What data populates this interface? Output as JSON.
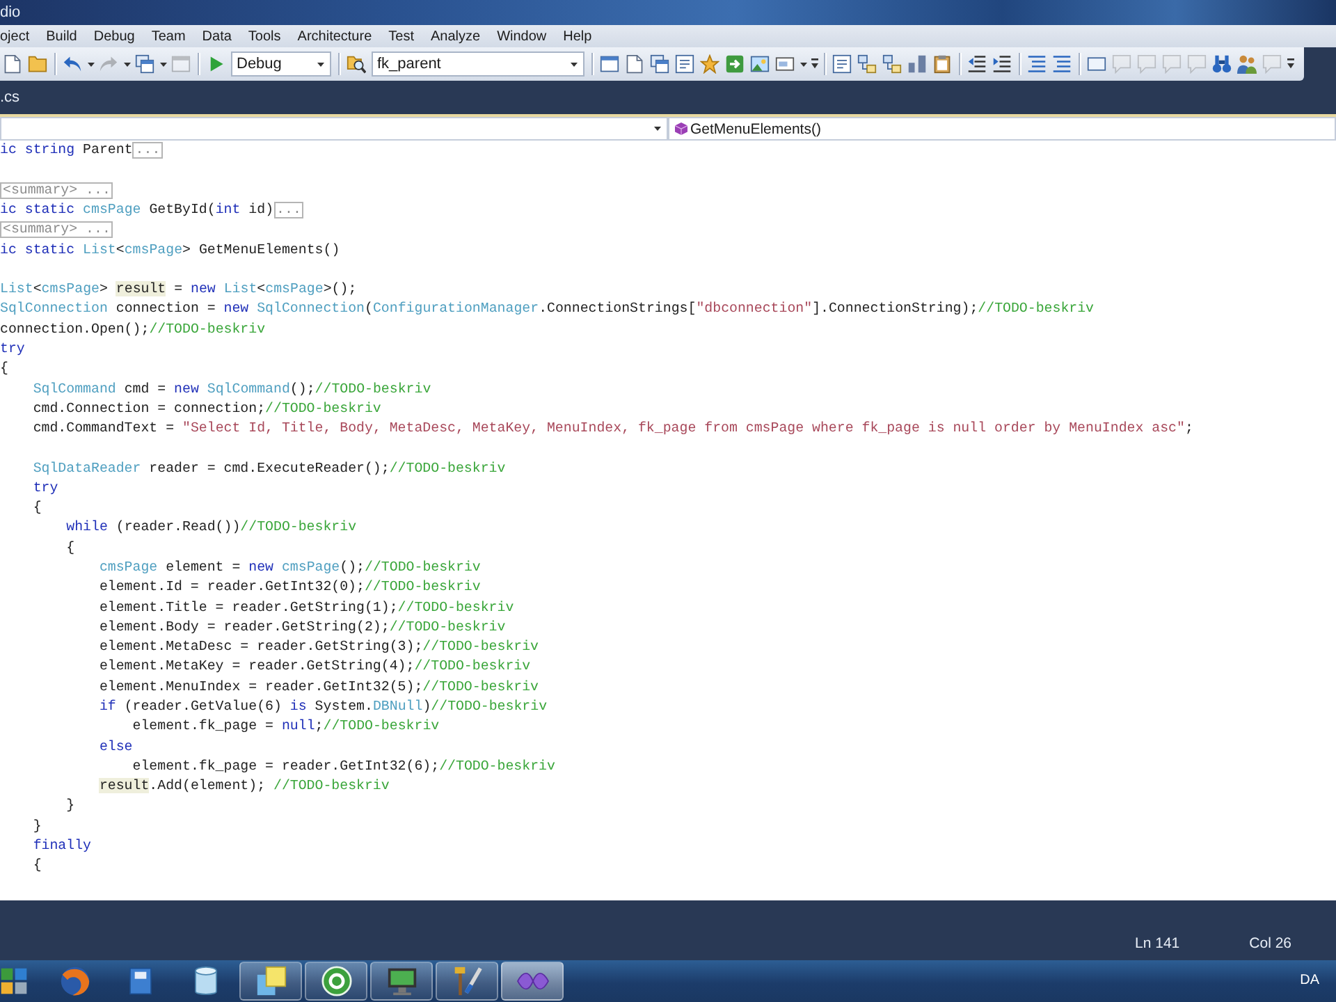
{
  "window": {
    "title": "dio"
  },
  "menu": [
    "oject",
    "Build",
    "Debug",
    "Team",
    "Data",
    "Tools",
    "Architecture",
    "Test",
    "Analyze",
    "Window",
    "Help"
  ],
  "toolbar": {
    "configuration": "Debug",
    "find": "fk_parent",
    "buttons": [
      {
        "disabled": false
      },
      {
        "disabled": false
      },
      {
        "disabled": false
      },
      {
        "disabled": true
      },
      {
        "disabled": false
      },
      {
        "disabled": true
      },
      {
        "disabled": false
      },
      {
        "disabled": false
      },
      {
        "disabled": false
      },
      {
        "disabled": false
      },
      {
        "disabled": false
      },
      {
        "disabled": false
      },
      {
        "disabled": false
      },
      {
        "disabled": false
      },
      {
        "disabled": false
      },
      {
        "disabled": false
      },
      {
        "disabled": false
      },
      {
        "disabled": false
      },
      {
        "disabled": false
      },
      {
        "disabled": false
      },
      {
        "disabled": false
      },
      {
        "disabled": false
      },
      {
        "disabled": false
      },
      {
        "disabled": false
      },
      {
        "disabled": false
      },
      {
        "disabled": false
      },
      {
        "disabled": true
      },
      {
        "disabled": true
      },
      {
        "disabled": true
      },
      {
        "disabled": true
      },
      {
        "disabled": false
      },
      {
        "disabled": false
      },
      {
        "disabled": true
      }
    ]
  },
  "tabs": [
    {
      "label": ".cs",
      "selected": false
    }
  ],
  "navigation": {
    "member": "GetMenuElements()"
  },
  "code": {
    "lines": [
      {
        "kind": "code",
        "tokens": [
          {
            "kind": "keyword",
            "text": "ic string"
          },
          {
            "kind": "plain",
            "text": " Parent"
          },
          {
            "kind": "collapsed",
            "text": "..."
          }
        ]
      },
      {
        "kind": "blank"
      },
      {
        "kind": "code",
        "tokens": [
          {
            "kind": "collapsed",
            "text": "<summary> ..."
          }
        ]
      },
      {
        "kind": "code",
        "tokens": [
          {
            "kind": "keyword",
            "text": "ic static "
          },
          {
            "kind": "type",
            "text": "cmsPage"
          },
          {
            "kind": "plain",
            "text": " GetById("
          },
          {
            "kind": "keyword",
            "text": "int"
          },
          {
            "kind": "plain",
            "text": " id)"
          },
          {
            "kind": "collapsed",
            "text": "..."
          }
        ]
      },
      {
        "kind": "code",
        "tokens": [
          {
            "kind": "collapsed",
            "text": "<summary> ..."
          }
        ]
      },
      {
        "kind": "code",
        "tokens": [
          {
            "kind": "keyword",
            "text": "ic static "
          },
          {
            "kind": "type",
            "text": "List"
          },
          {
            "kind": "plain",
            "text": "<"
          },
          {
            "kind": "type",
            "text": "cmsPage"
          },
          {
            "kind": "plain",
            "text": "> GetMenuElements()"
          }
        ]
      },
      {
        "kind": "blank"
      },
      {
        "kind": "code",
        "tokens": [
          {
            "kind": "type",
            "text": "List"
          },
          {
            "kind": "plain",
            "text": "<"
          },
          {
            "kind": "type",
            "text": "cmsPage"
          },
          {
            "kind": "plain",
            "text": "> "
          },
          {
            "kind": "highlight",
            "text": "result"
          },
          {
            "kind": "plain",
            "text": " = "
          },
          {
            "kind": "keyword",
            "text": "new "
          },
          {
            "kind": "type",
            "text": "List"
          },
          {
            "kind": "plain",
            "text": "<"
          },
          {
            "kind": "type",
            "text": "cmsPage"
          },
          {
            "kind": "plain",
            "text": ">();"
          }
        ]
      },
      {
        "kind": "code",
        "tokens": [
          {
            "kind": "type",
            "text": "SqlConnection"
          },
          {
            "kind": "plain",
            "text": " connection = "
          },
          {
            "kind": "keyword",
            "text": "new "
          },
          {
            "kind": "type",
            "text": "SqlConnection"
          },
          {
            "kind": "plain",
            "text": "("
          },
          {
            "kind": "type",
            "text": "ConfigurationManager"
          },
          {
            "kind": "plain",
            "text": ".ConnectionStrings["
          },
          {
            "kind": "string",
            "text": "\"dbconnection\""
          },
          {
            "kind": "plain",
            "text": "].ConnectionString);"
          },
          {
            "kind": "comment",
            "text": "//TODO-beskriv"
          }
        ]
      },
      {
        "kind": "code",
        "tokens": [
          {
            "kind": "plain",
            "text": "connection.Open();"
          },
          {
            "kind": "comment",
            "text": "//TODO-beskriv"
          }
        ]
      },
      {
        "kind": "code",
        "tokens": [
          {
            "kind": "keyword",
            "text": "try"
          }
        ]
      },
      {
        "kind": "code",
        "tokens": [
          {
            "kind": "plain",
            "text": "{"
          }
        ],
        "children": [
          {
            "kind": "code",
            "tokens": [
              {
                "kind": "type",
                "text": "SqlCommand"
              },
              {
                "kind": "plain",
                "text": " cmd = "
              },
              {
                "kind": "keyword",
                "text": "new "
              },
              {
                "kind": "type",
                "text": "SqlCommand"
              },
              {
                "kind": "plain",
                "text": "();"
              },
              {
                "kind": "comment",
                "text": "//TODO-beskriv"
              }
            ]
          },
          {
            "kind": "code",
            "tokens": [
              {
                "kind": "plain",
                "text": "cmd.Connection = connection;"
              },
              {
                "kind": "comment",
                "text": "//TODO-beskriv"
              }
            ]
          },
          {
            "kind": "code",
            "tokens": [
              {
                "kind": "plain",
                "text": "cmd.CommandText = "
              },
              {
                "kind": "string",
                "text": "\"Select Id, Title, Body, MetaDesc, MetaKey, MenuIndex, fk_page from cmsPage where fk_page is null order by MenuIndex asc\""
              },
              {
                "kind": "plain",
                "text": ";"
              }
            ]
          },
          {
            "kind": "blank"
          },
          {
            "kind": "code",
            "tokens": [
              {
                "kind": "type",
                "text": "SqlDataReader"
              },
              {
                "kind": "plain",
                "text": " reader = cmd.ExecuteReader();"
              },
              {
                "kind": "comment",
                "text": "//TODO-beskriv"
              }
            ]
          },
          {
            "kind": "code",
            "tokens": [
              {
                "kind": "keyword",
                "text": "try"
              }
            ]
          },
          {
            "kind": "code",
            "tokens": [
              {
                "kind": "plain",
                "text": "{"
              }
            ],
            "children": [
              {
                "kind": "code",
                "tokens": [
                  {
                    "kind": "keyword",
                    "text": "while"
                  },
                  {
                    "kind": "plain",
                    "text": " (reader.Read())"
                  },
                  {
                    "kind": "comment",
                    "text": "//TODO-beskriv"
                  }
                ]
              },
              {
                "kind": "code",
                "tokens": [
                  {
                    "kind": "plain",
                    "text": "{"
                  }
                ],
                "children": [
                  {
                    "kind": "code",
                    "tokens": [
                      {
                        "kind": "type",
                        "text": "cmsPage"
                      },
                      {
                        "kind": "plain",
                        "text": " element = "
                      },
                      {
                        "kind": "keyword",
                        "text": "new "
                      },
                      {
                        "kind": "type",
                        "text": "cmsPage"
                      },
                      {
                        "kind": "plain",
                        "text": "();"
                      },
                      {
                        "kind": "comment",
                        "text": "//TODO-beskriv"
                      }
                    ]
                  },
                  {
                    "kind": "code",
                    "tokens": [
                      {
                        "kind": "plain",
                        "text": "element.Id = reader.GetInt32(0);"
                      },
                      {
                        "kind": "comment",
                        "text": "//TODO-beskriv"
                      }
                    ]
                  },
                  {
                    "kind": "code",
                    "tokens": [
                      {
                        "kind": "plain",
                        "text": "element.Title = reader.GetString(1);"
                      },
                      {
                        "kind": "comment",
                        "text": "//TODO-beskriv"
                      }
                    ]
                  },
                  {
                    "kind": "code",
                    "tokens": [
                      {
                        "kind": "plain",
                        "text": "element.Body = reader.GetString(2);"
                      },
                      {
                        "kind": "comment",
                        "text": "//TODO-beskriv"
                      }
                    ]
                  },
                  {
                    "kind": "code",
                    "tokens": [
                      {
                        "kind": "plain",
                        "text": "element.MetaDesc = reader.GetString(3);"
                      },
                      {
                        "kind": "comment",
                        "text": "//TODO-beskriv"
                      }
                    ]
                  },
                  {
                    "kind": "code",
                    "tokens": [
                      {
                        "kind": "plain",
                        "text": "element.MetaKey = reader.GetString(4);"
                      },
                      {
                        "kind": "comment",
                        "text": "//TODO-beskriv"
                      }
                    ]
                  },
                  {
                    "kind": "code",
                    "tokens": [
                      {
                        "kind": "plain",
                        "text": "element.MenuIndex = reader.GetInt32(5);"
                      },
                      {
                        "kind": "comment",
                        "text": "//TODO-beskriv"
                      }
                    ]
                  },
                  {
                    "kind": "code",
                    "tokens": [
                      {
                        "kind": "keyword",
                        "text": "if"
                      },
                      {
                        "kind": "plain",
                        "text": " (reader.GetValue(6) "
                      },
                      {
                        "kind": "keyword",
                        "text": "is"
                      },
                      {
                        "kind": "plain",
                        "text": " System."
                      },
                      {
                        "kind": "type",
                        "text": "DBNull"
                      },
                      {
                        "kind": "plain",
                        "text": ")"
                      },
                      {
                        "kind": "comment",
                        "text": "//TODO-beskriv"
                      }
                    ],
                    "children": [
                      {
                        "kind": "code",
                        "tokens": [
                          {
                            "kind": "plain",
                            "text": "element.fk_page = "
                          },
                          {
                            "kind": "keyword",
                            "text": "null"
                          },
                          {
                            "kind": "plain",
                            "text": ";"
                          },
                          {
                            "kind": "comment",
                            "text": "//TODO-beskriv"
                          }
                        ]
                      }
                    ]
                  },
                  {
                    "kind": "code",
                    "tokens": [
                      {
                        "kind": "keyword",
                        "text": "else"
                      }
                    ],
                    "children": [
                      {
                        "kind": "code",
                        "tokens": [
                          {
                            "kind": "plain",
                            "text": "element.fk_page = reader.GetInt32(6);"
                          },
                          {
                            "kind": "comment",
                            "text": "//TODO-beskriv"
                          }
                        ]
                      }
                    ]
                  },
                  {
                    "kind": "code",
                    "tokens": [
                      {
                        "kind": "highlight",
                        "text": "result"
                      },
                      {
                        "kind": "plain",
                        "text": ".Add(element); "
                      },
                      {
                        "kind": "comment",
                        "text": "//TODO-beskriv"
                      }
                    ]
                  }
                ]
              },
              {
                "kind": "code",
                "tokens": [
                  {
                    "kind": "plain",
                    "text": "}"
                  }
                ]
              }
            ]
          },
          {
            "kind": "code",
            "tokens": [
              {
                "kind": "plain",
                "text": "}"
              }
            ]
          },
          {
            "kind": "code",
            "tokens": [
              {
                "kind": "keyword",
                "text": "finally"
              }
            ]
          },
          {
            "kind": "code",
            "tokens": [
              {
                "kind": "plain",
                "text": "{"
              }
            ]
          }
        ]
      }
    ]
  },
  "status_bar": {
    "line": "Ln 141",
    "column": "Col 26"
  },
  "taskbar": {
    "apps": [
      {
        "running": false,
        "active": false
      },
      {
        "running": false,
        "active": false
      },
      {
        "running": false,
        "active": false
      },
      {
        "running": false,
        "active": false
      },
      {
        "running": true,
        "active": false
      },
      {
        "running": true,
        "active": false
      },
      {
        "running": true,
        "active": false
      },
      {
        "running": true,
        "active": false
      },
      {
        "running": true,
        "active": true
      }
    ],
    "language": "DA"
  }
}
